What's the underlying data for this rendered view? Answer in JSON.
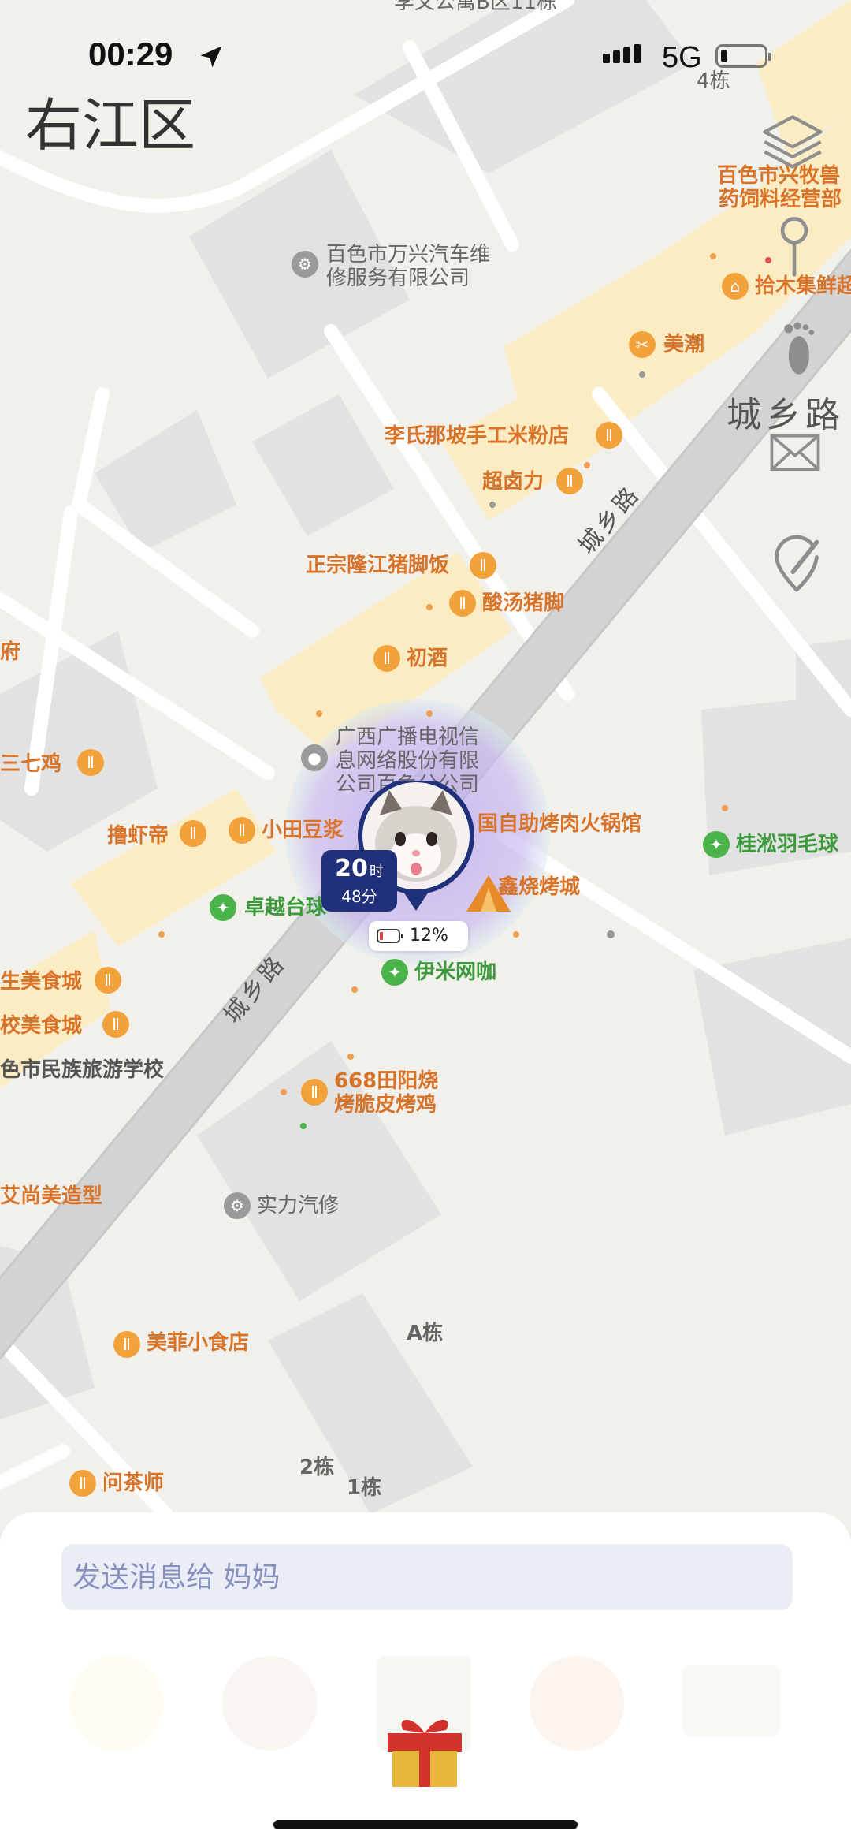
{
  "status_bar": {
    "time": "00:29",
    "network": "5G"
  },
  "map": {
    "district": "右江区",
    "roads": {
      "main_1": "城乡路",
      "main_2": "城乡路",
      "main_right": "城乡路"
    },
    "pois": [
      {
        "name": "李文公寓B区11栋",
        "type": "gray"
      },
      {
        "name": "4栋",
        "type": "gray"
      },
      {
        "name": "百色市万兴汽车维",
        "type": "gray"
      },
      {
        "name": "修服务有限公司",
        "type": "gray"
      },
      {
        "name": "百色市兴牧兽",
        "type": "food"
      },
      {
        "name": "药饲料经营部",
        "type": "food"
      },
      {
        "name": "拾木集鲜超",
        "type": "food"
      },
      {
        "name": "美潮",
        "type": "food"
      },
      {
        "name": "李氏那坡手工米粉店",
        "type": "food"
      },
      {
        "name": "超卤力",
        "type": "food"
      },
      {
        "name": "正宗隆江猪脚饭",
        "type": "food"
      },
      {
        "name": "酸汤猪脚",
        "type": "food"
      },
      {
        "name": "初酒",
        "type": "food"
      },
      {
        "name": "广西广播电视信",
        "type": "gray"
      },
      {
        "name": "息网络股份有限",
        "type": "gray"
      },
      {
        "name": "公司百色分公司",
        "type": "gray"
      },
      {
        "name": "三七鸡",
        "type": "food"
      },
      {
        "name": "撸虾帝",
        "type": "food"
      },
      {
        "name": "小田豆浆",
        "type": "food"
      },
      {
        "name": "国自助烤肉火锅馆",
        "type": "food"
      },
      {
        "name": "桂淞羽毛球",
        "type": "green"
      },
      {
        "name": "卓越台球",
        "type": "green"
      },
      {
        "name": "鑫烧烤城",
        "type": "food"
      },
      {
        "name": "伊米网咖",
        "type": "green"
      },
      {
        "name": "生美食城",
        "type": "food"
      },
      {
        "name": "校美食城",
        "type": "food"
      },
      {
        "name": "色市民族旅游学校",
        "type": "gray"
      },
      {
        "name": "668田阳烧",
        "type": "food"
      },
      {
        "name": "烤脆皮烤鸡",
        "type": "food"
      },
      {
        "name": "艾尚美造型",
        "type": "food"
      },
      {
        "name": "实力汽修",
        "type": "gray"
      },
      {
        "name": "美菲小食店",
        "type": "food"
      },
      {
        "name": "A栋",
        "type": "gray"
      },
      {
        "name": "2栋",
        "type": "gray"
      },
      {
        "name": "1栋",
        "type": "gray"
      },
      {
        "name": "问茶师",
        "type": "food"
      },
      {
        "name": "府",
        "type": "food"
      }
    ]
  },
  "tracker": {
    "hours": "20",
    "hours_unit": "时",
    "minutes": "48分",
    "battery": "12%"
  },
  "side_toolbar": {
    "layers": "layers-icon",
    "pin": "location-pin-icon",
    "footprint": "footprint-icon",
    "mail": "mail-icon",
    "tag": "tag-icon"
  },
  "bottom_sheet": {
    "message_placeholder": "发送消息给 妈妈"
  },
  "colors": {
    "accent": "#20307a",
    "poi_food": "#d8732a",
    "poi_green": "#3c9a3c",
    "map_bg": "#f2f0ea"
  }
}
